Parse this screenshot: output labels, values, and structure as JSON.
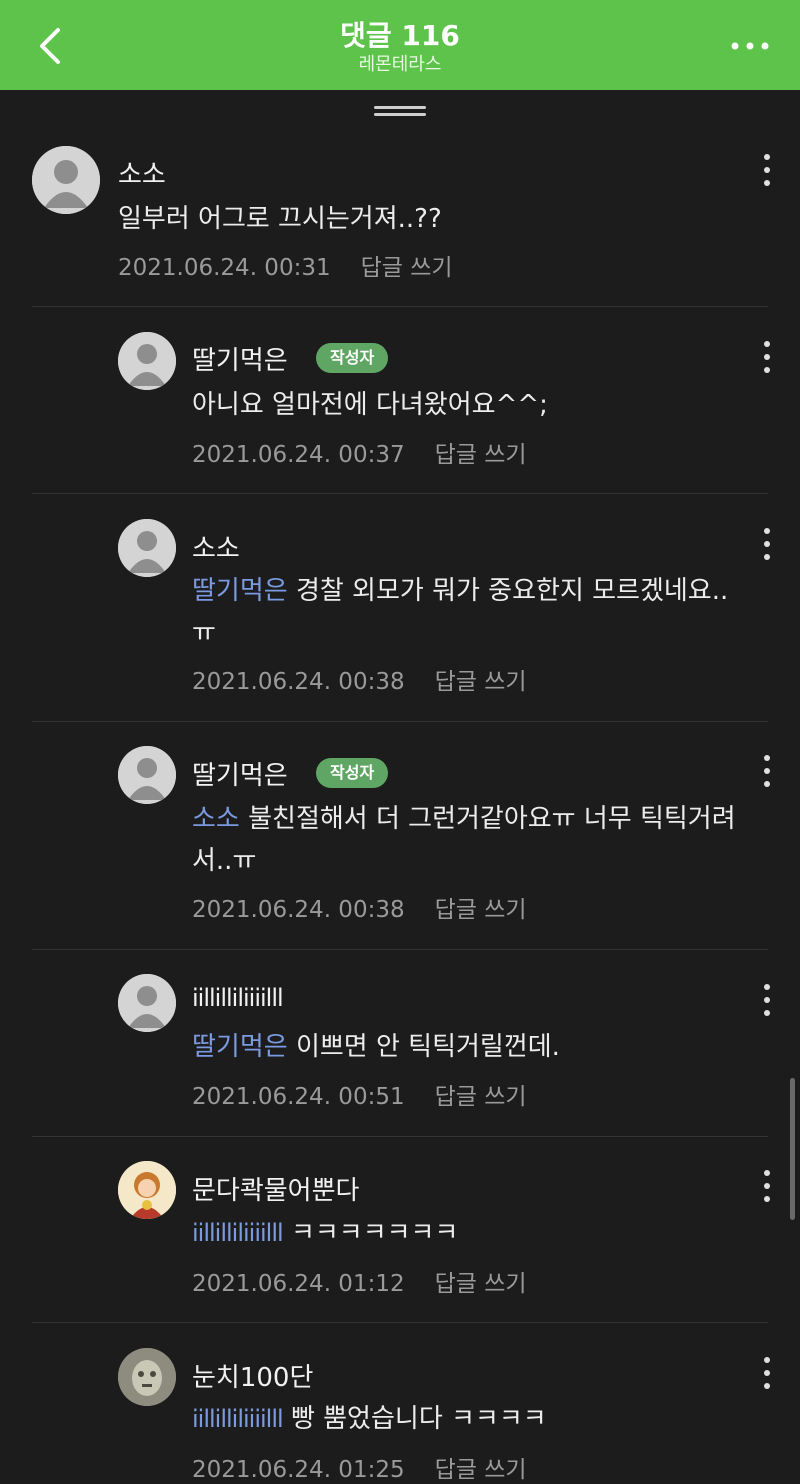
{
  "header": {
    "title": "댓글 116",
    "subtitle": "레몬테라스",
    "bg_color": "#5ec34b"
  },
  "comments": [
    {
      "author": "소소",
      "badge": "",
      "mention": "",
      "text": "일부러 어그로 끄시는거져..??",
      "date": "2021.06.24. 00:31",
      "reply": "답글 쓰기"
    },
    {
      "author": "딸기먹은",
      "badge": "작성자",
      "mention": "",
      "text": "아니요 얼마전에 다녀왔어요^^;",
      "date": "2021.06.24. 00:37",
      "reply": "답글 쓰기"
    },
    {
      "author": "소소",
      "badge": "",
      "mention": "딸기먹은",
      "text": "경찰 외모가 뭐가 중요한지 모르겠네요.. ㅠ",
      "date": "2021.06.24. 00:38",
      "reply": "답글 쓰기"
    },
    {
      "author": "딸기먹은",
      "badge": "작성자",
      "mention": "소소",
      "text": "불친절해서 더 그런거같아요ㅠ  너무 틱틱거려서..ㅠ",
      "date": "2021.06.24. 00:38",
      "reply": "답글 쓰기"
    },
    {
      "author": "iillilliliiiilll",
      "badge": "",
      "mention": "딸기먹은",
      "text": "이쁘면 안 틱틱거릴껀데.",
      "date": "2021.06.24. 00:51",
      "reply": "답글 쓰기"
    },
    {
      "author": "문다콱물어뿐다",
      "badge": "",
      "mention": "iillilliliiiilll",
      "text": "ㅋㅋㅋㅋㅋㅋㅋ",
      "date": "2021.06.24. 01:12",
      "reply": "답글 쓰기"
    },
    {
      "author": "눈치100단",
      "badge": "",
      "mention": "iillilliliiiilll",
      "text": "빵 뿜었습니다 ㅋㅋㅋㅋ",
      "date": "2021.06.24. 01:25",
      "reply": "답글 쓰기"
    }
  ]
}
